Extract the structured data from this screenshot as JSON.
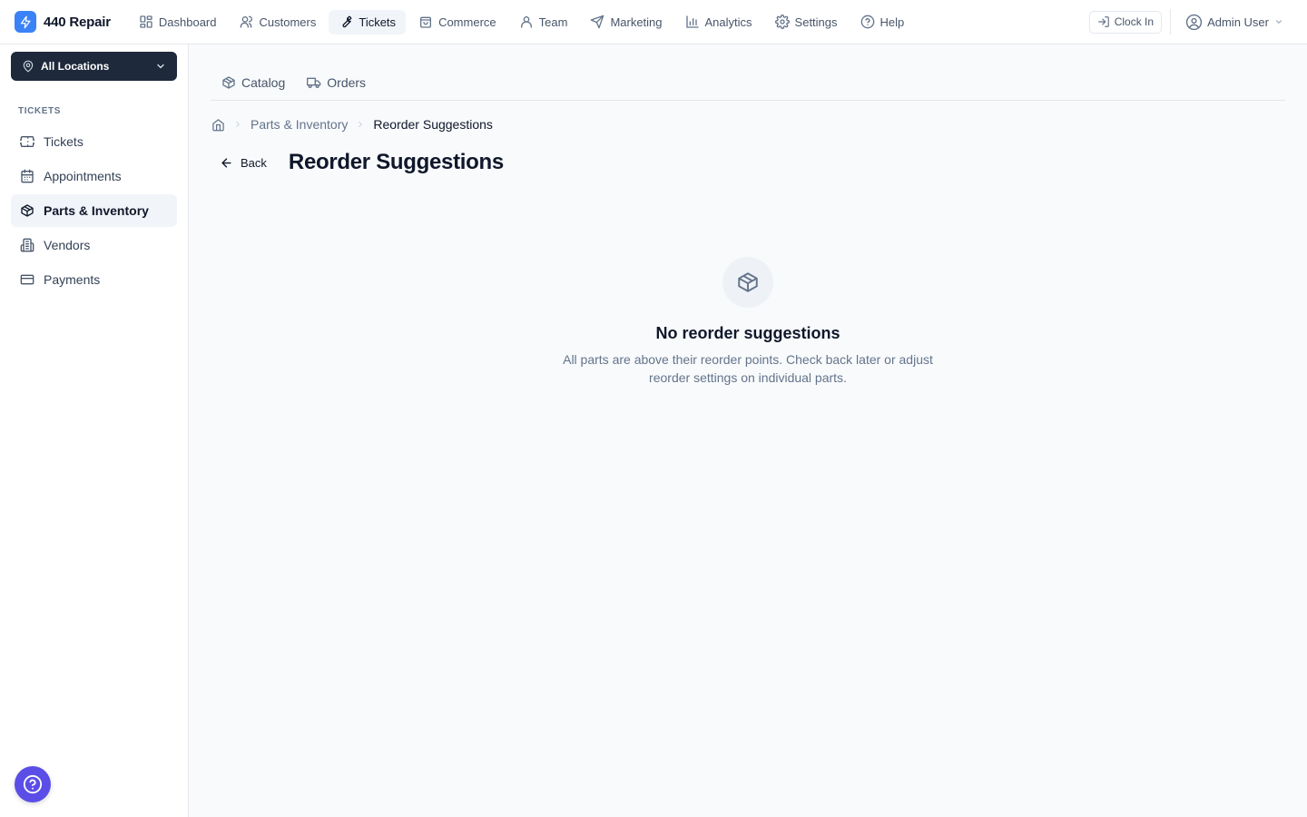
{
  "brand": {
    "name": "440 Repair",
    "logo_icon": "bolt-icon",
    "logo_color": "#3b82f6"
  },
  "nav": {
    "items": [
      {
        "label": "Dashboard",
        "icon": "dashboard-icon",
        "active": false
      },
      {
        "label": "Customers",
        "icon": "users-icon",
        "active": false
      },
      {
        "label": "Tickets",
        "icon": "wrench-icon",
        "active": true
      },
      {
        "label": "Commerce",
        "icon": "shopping-bag-icon",
        "active": false
      },
      {
        "label": "Team",
        "icon": "user-icon",
        "active": false
      },
      {
        "label": "Marketing",
        "icon": "send-icon",
        "active": false
      },
      {
        "label": "Analytics",
        "icon": "bar-chart-icon",
        "active": false
      },
      {
        "label": "Settings",
        "icon": "gear-icon",
        "active": false
      },
      {
        "label": "Help",
        "icon": "help-circle-icon",
        "active": false
      }
    ]
  },
  "topbar": {
    "clock_in_label": "Clock In",
    "user_name": "Admin User"
  },
  "sidebar": {
    "location_selector": "All Locations",
    "section_label": "TICKETS",
    "items": [
      {
        "label": "Tickets",
        "icon": "ticket-icon",
        "active": false
      },
      {
        "label": "Appointments",
        "icon": "calendar-icon",
        "active": false
      },
      {
        "label": "Parts & Inventory",
        "icon": "package-icon",
        "active": true
      },
      {
        "label": "Vendors",
        "icon": "building-icon",
        "active": false
      },
      {
        "label": "Payments",
        "icon": "credit-card-icon",
        "active": false
      }
    ],
    "help_fab_color": "#5b4ee6"
  },
  "subtabs": [
    {
      "label": "Catalog",
      "icon": "package-icon"
    },
    {
      "label": "Orders",
      "icon": "truck-icon"
    }
  ],
  "breadcrumb": {
    "parent": "Parts & Inventory",
    "current": "Reorder Suggestions"
  },
  "page": {
    "back_label": "Back",
    "title": "Reorder Suggestions"
  },
  "empty_state": {
    "icon": "package-icon",
    "title": "No reorder suggestions",
    "description": "All parts are above their reorder points. Check back later or adjust reorder settings on individual parts."
  }
}
